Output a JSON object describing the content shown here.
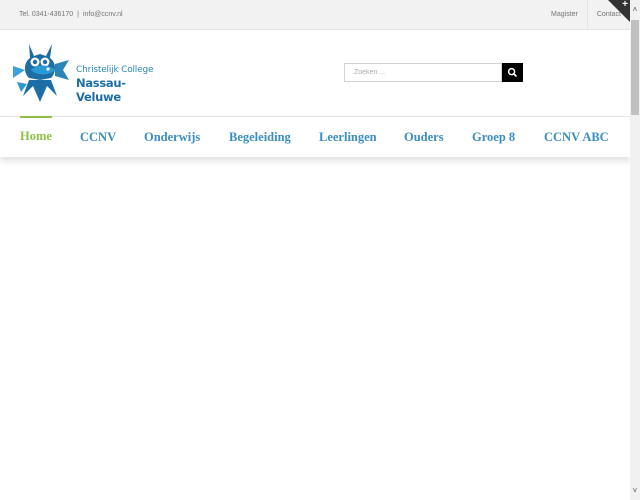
{
  "topbar": {
    "phone": "Tel. 0341-436170",
    "separator": "|",
    "email": "info@ccnv.nl",
    "menu": [
      {
        "label": "Magister"
      },
      {
        "label": "Contact"
      }
    ],
    "toggle_symbol": "+"
  },
  "logo": {
    "line1": "Christelijk College",
    "line2": "Nassau-Veluwe",
    "icon": "owl-fish-logo"
  },
  "search": {
    "placeholder": "Zoeken ...",
    "icon": "search-icon"
  },
  "nav": {
    "items": [
      {
        "label": "Home",
        "active": true
      },
      {
        "label": "CCNV"
      },
      {
        "label": "Onderwijs"
      },
      {
        "label": "Begeleiding"
      },
      {
        "label": "Leerlingen"
      },
      {
        "label": "Ouders"
      },
      {
        "label": "Groep 8"
      },
      {
        "label": "CCNV ABC"
      }
    ]
  },
  "scrollbar": {
    "up_arrow": "˄",
    "down_arrow": "˅"
  },
  "colors": {
    "brand_blue": "#3a8ec0",
    "active_green": "#8fbf44",
    "logo_dark_blue": "#1e6ea6",
    "topbar_bg": "#f2f2f2"
  }
}
